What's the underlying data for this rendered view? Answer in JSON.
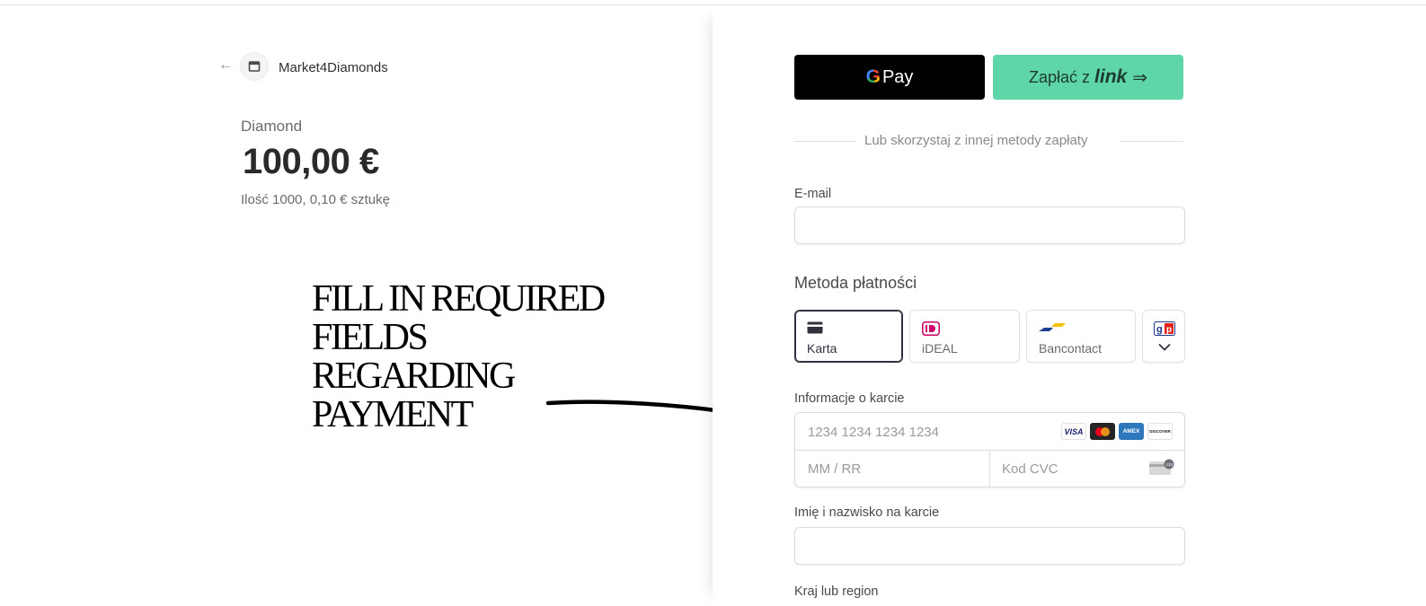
{
  "merchant": {
    "back_icon": "arrow-left-icon",
    "logo_icon": "store-icon",
    "name": "Market4Diamonds"
  },
  "product": {
    "name": "Diamond",
    "price": "100,00 €",
    "unit_info": "Ilość 1000, 0,10 € sztukę"
  },
  "annotation": {
    "lines": [
      "FILL IN  REQUIRED",
      "FIELDS",
      "REGARDING",
      "PAYMENT"
    ]
  },
  "express": {
    "gpay_g": "G",
    "gpay_label": "Pay",
    "link_prefix": "Zapłać z",
    "link_word": "link",
    "link_arrow": "⇒"
  },
  "divider_text": "Lub skorzystaj z innej metody zapłaty",
  "email": {
    "label": "E-mail",
    "value": ""
  },
  "payment_method": {
    "title": "Metoda płatności",
    "tabs": [
      {
        "label": "Karta",
        "icon": "card-icon",
        "selected": true
      },
      {
        "label": "iDEAL",
        "icon": "ideal-icon",
        "selected": false
      },
      {
        "label": "Bancontact",
        "icon": "bancontact-icon",
        "selected": false
      }
    ],
    "more_icon": "chevron-down-icon",
    "more_brand_icon": "giropay-icon"
  },
  "card": {
    "label": "Informacje o karcie",
    "number_placeholder": "1234 1234 1234 1234",
    "expiry_placeholder": "MM / RR",
    "cvc_placeholder": "Kod CVC",
    "brands": [
      "VISA",
      "mastercard",
      "AMEX",
      "DISCOVER"
    ],
    "cvc_icon": "cvc-card-icon"
  },
  "cardholder": {
    "label": "Imię i nazwisko na karcie",
    "value": ""
  },
  "country": {
    "label": "Kraj lub region"
  },
  "colors": {
    "link_green": "#5ed6a8",
    "gpay_black": "#000000",
    "selected_border": "#30313d"
  }
}
